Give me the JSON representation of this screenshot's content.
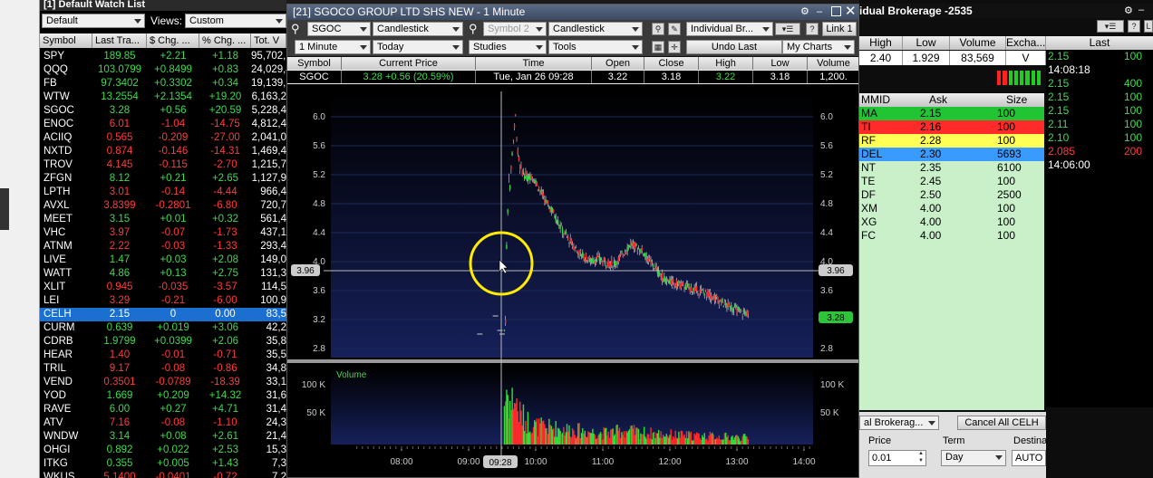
{
  "watchlist": {
    "title": "[1] Default Watch List",
    "list_name": "Default",
    "views_label": "Views:",
    "view_value": "Custom",
    "headers": [
      "Symbol",
      "Last Tra...",
      "$ Chg. ...",
      "% Chg. ...",
      "Tot. V"
    ],
    "rows": [
      {
        "sym": "SPY",
        "last": "189.85",
        "chg": "+2.21",
        "pct": "+1.18",
        "vol": "95,702,7",
        "dir": "up"
      },
      {
        "sym": "QQQ",
        "last": "103.0799",
        "chg": "+0.8499",
        "pct": "+0.83",
        "vol": "24,029,4",
        "dir": "up"
      },
      {
        "sym": "FB",
        "last": "97.3402",
        "chg": "+0.3302",
        "pct": "+0.34",
        "vol": "19,139,6",
        "dir": "up"
      },
      {
        "sym": "WTW",
        "last": "13.2554",
        "chg": "+2.1354",
        "pct": "+19.20",
        "vol": "6,163,2",
        "dir": "up"
      },
      {
        "sym": "SGOC",
        "last": "3.28",
        "chg": "+0.56",
        "pct": "+20.59",
        "vol": "5,228,4",
        "dir": "up"
      },
      {
        "sym": "ENOC",
        "last": "6.01",
        "chg": "-1.04",
        "pct": "-14.75",
        "vol": "4,812,4",
        "dir": "dn"
      },
      {
        "sym": "ACIIQ",
        "last": "0.565",
        "chg": "-0.209",
        "pct": "-27.00",
        "vol": "2,041,0",
        "dir": "dn"
      },
      {
        "sym": "NXTD",
        "last": "0.874",
        "chg": "-0.146",
        "pct": "-14.31",
        "vol": "1,469,4",
        "dir": "dn"
      },
      {
        "sym": "TROV",
        "last": "4.145",
        "chg": "-0.115",
        "pct": "-2.70",
        "vol": "1,215,7",
        "dir": "dn"
      },
      {
        "sym": "ZFGN",
        "last": "8.12",
        "chg": "+0.21",
        "pct": "+2.65",
        "vol": "1,127,9",
        "dir": "up"
      },
      {
        "sym": "LPTH",
        "last": "3.01",
        "chg": "-0.14",
        "pct": "-4.44",
        "vol": "966,4",
        "dir": "dn"
      },
      {
        "sym": "AVXL",
        "last": "3.8399",
        "chg": "-0.2801",
        "pct": "-6.80",
        "vol": "720,7",
        "dir": "dn"
      },
      {
        "sym": "MEET",
        "last": "3.15",
        "chg": "+0.01",
        "pct": "+0.32",
        "vol": "561,4",
        "dir": "up"
      },
      {
        "sym": "VHC",
        "last": "3.97",
        "chg": "-0.07",
        "pct": "-1.73",
        "vol": "437,1",
        "dir": "dn"
      },
      {
        "sym": "ATNM",
        "last": "2.22",
        "chg": "-0.03",
        "pct": "-1.33",
        "vol": "293,4",
        "dir": "dn"
      },
      {
        "sym": "LIVE",
        "last": "1.47",
        "chg": "+0.03",
        "pct": "+2.08",
        "vol": "149,0",
        "dir": "up"
      },
      {
        "sym": "WATT",
        "last": "4.86",
        "chg": "+0.13",
        "pct": "+2.75",
        "vol": "131,3",
        "dir": "up"
      },
      {
        "sym": "XLIT",
        "last": "0.945",
        "chg": "-0.035",
        "pct": "-3.57",
        "vol": "114,5",
        "dir": "dn"
      },
      {
        "sym": "LEI",
        "last": "3.29",
        "chg": "-0.21",
        "pct": "-6.00",
        "vol": "100,9",
        "dir": "dn"
      },
      {
        "sym": "CELH",
        "last": "2.15",
        "chg": "0",
        "pct": "0.00",
        "vol": "83,5",
        "dir": "flat"
      },
      {
        "sym": "CURM",
        "last": "0.639",
        "chg": "+0.019",
        "pct": "+3.06",
        "vol": "42,2",
        "dir": "up"
      },
      {
        "sym": "CDRB",
        "last": "1.9799",
        "chg": "+0.0399",
        "pct": "+2.06",
        "vol": "35,8",
        "dir": "up"
      },
      {
        "sym": "HEAR",
        "last": "1.40",
        "chg": "-0.01",
        "pct": "-0.71",
        "vol": "35,5",
        "dir": "dn"
      },
      {
        "sym": "TRIL",
        "last": "9.17",
        "chg": "-0.08",
        "pct": "-0.86",
        "vol": "34,8",
        "dir": "dn"
      },
      {
        "sym": "VEND",
        "last": "0.3501",
        "chg": "-0.0789",
        "pct": "-18.39",
        "vol": "33,1",
        "dir": "dn"
      },
      {
        "sym": "YOD",
        "last": "1.669",
        "chg": "+0.209",
        "pct": "+14.32",
        "vol": "31,6",
        "dir": "up"
      },
      {
        "sym": "RAVE",
        "last": "6.00",
        "chg": "+0.27",
        "pct": "+4.71",
        "vol": "31,4",
        "dir": "up"
      },
      {
        "sym": "ATV",
        "last": "7.16",
        "chg": "-0.08",
        "pct": "-1.10",
        "vol": "24,3",
        "dir": "dn"
      },
      {
        "sym": "WNDW",
        "last": "3.14",
        "chg": "+0.08",
        "pct": "+2.61",
        "vol": "21,4",
        "dir": "up"
      },
      {
        "sym": "OHGI",
        "last": "0.892",
        "chg": "+0.022",
        "pct": "+2.53",
        "vol": "15,3",
        "dir": "up"
      },
      {
        "sym": "ITKG",
        "last": "0.355",
        "chg": "+0.005",
        "pct": "+1.43",
        "vol": "7,3",
        "dir": "up"
      },
      {
        "sym": "WKUS",
        "last": "5.1400",
        "chg": "-0.0401",
        "pct": "-0.72",
        "vol": "7,2",
        "dir": "dn"
      }
    ]
  },
  "chart_window": {
    "title": "[21] SGOCO GROUP LTD SHS NEW - 1 Minute",
    "symbol": "SGOC",
    "type1": "Candlestick",
    "symbol2_placeholder": "Symbol 2",
    "type2": "Candlestick",
    "broker": "Individual Br...",
    "link": "Link 1",
    "interval": "1 Minute",
    "range": "Today",
    "studies": "Studies",
    "tools": "Tools",
    "undo": "Undo Last",
    "my_charts": "My Charts",
    "quote_headers": [
      "Symbol",
      "Current Price",
      "Time",
      "Open",
      "Close",
      "High",
      "Low",
      "Volume"
    ],
    "quote": {
      "symbol": "SGOC",
      "price": "3.28",
      "change": "+0.56 (20.59%)",
      "time": "Tue, Jan 26  09:28",
      "open": "3.22",
      "close": "3.18",
      "high": "3.22",
      "low": "3.18",
      "volume": "1,200."
    },
    "price_ticks": [
      "6.0",
      "5.6",
      "5.2",
      "4.8",
      "4.4",
      "4.0",
      "3.6",
      "3.2",
      "2.8"
    ],
    "cross_price": "3.96",
    "last_price": "3.28",
    "volume_label": "Volume",
    "vol_ticks": [
      "100 K",
      "50 K"
    ],
    "time_ticks": [
      "08:00",
      "09:00",
      "10:00",
      "11:00",
      "12:00",
      "13:00",
      "14:00"
    ],
    "cursor_time": "09:28"
  },
  "chart_data": {
    "type": "candlestick",
    "x_unit": "minutes since 08:00",
    "ylim": [
      2.7,
      6.35
    ],
    "price_path": [
      [
        92,
        3.05
      ],
      [
        93,
        3.2
      ],
      [
        94,
        4.2
      ],
      [
        95,
        4.7
      ],
      [
        96,
        5.2
      ],
      [
        97,
        5.0
      ],
      [
        98,
        5.3
      ],
      [
        100,
        5.7
      ],
      [
        102,
        6.0
      ],
      [
        104,
        5.5
      ],
      [
        106,
        5.3
      ],
      [
        108,
        5.25
      ],
      [
        110,
        5.2
      ],
      [
        113,
        5.15
      ],
      [
        116,
        5.2
      ],
      [
        120,
        5.1
      ],
      [
        125,
        4.95
      ],
      [
        130,
        4.8
      ],
      [
        135,
        4.7
      ],
      [
        140,
        4.55
      ],
      [
        145,
        4.4
      ],
      [
        150,
        4.3
      ],
      [
        155,
        4.2
      ],
      [
        160,
        4.1
      ],
      [
        165,
        4.05
      ],
      [
        170,
        4.0
      ],
      [
        175,
        4.05
      ],
      [
        180,
        4.0
      ],
      [
        185,
        3.98
      ],
      [
        190,
        3.97
      ],
      [
        195,
        4.05
      ],
      [
        200,
        4.15
      ],
      [
        205,
        4.25
      ],
      [
        210,
        4.2
      ],
      [
        215,
        4.15
      ],
      [
        220,
        4.05
      ],
      [
        225,
        3.95
      ],
      [
        230,
        3.85
      ],
      [
        235,
        3.75
      ],
      [
        240,
        3.72
      ],
      [
        245,
        3.7
      ],
      [
        250,
        3.68
      ],
      [
        255,
        3.65
      ],
      [
        260,
        3.62
      ],
      [
        265,
        3.6
      ],
      [
        270,
        3.58
      ],
      [
        275,
        3.55
      ],
      [
        280,
        3.5
      ],
      [
        285,
        3.45
      ],
      [
        290,
        3.4
      ],
      [
        295,
        3.37
      ],
      [
        300,
        3.33
      ],
      [
        305,
        3.3
      ],
      [
        310,
        3.28
      ]
    ],
    "volume_profile": [
      [
        92,
        90
      ],
      [
        94,
        120
      ],
      [
        96,
        100
      ],
      [
        98,
        80
      ],
      [
        100,
        110
      ],
      [
        102,
        95
      ],
      [
        105,
        70
      ],
      [
        110,
        55
      ],
      [
        120,
        40
      ],
      [
        140,
        35
      ],
      [
        160,
        30
      ],
      [
        180,
        25
      ],
      [
        200,
        30
      ],
      [
        220,
        25
      ],
      [
        250,
        20
      ],
      [
        280,
        18
      ],
      [
        310,
        15
      ]
    ]
  },
  "level2": {
    "title": "idual Brokerage -2535",
    "lii_headers": [
      "High",
      "Low",
      "Volume",
      "Excha..."
    ],
    "lii_values": [
      "2.40",
      "1.929",
      "83,569",
      "V"
    ],
    "headers": [
      "MMID",
      "Ask",
      "Size"
    ],
    "rows": [
      {
        "mmid": "MA",
        "ask": "2.15",
        "size": "100",
        "bg": "#21c433"
      },
      {
        "mmid": "TI",
        "ask": "2.16",
        "size": "100",
        "bg": "#ff2a2a"
      },
      {
        "mmid": "RF",
        "ask": "2.28",
        "size": "100",
        "bg": "#ffff55"
      },
      {
        "mmid": "DEL",
        "ask": "2.30",
        "size": "5693",
        "bg": "#3a9bff"
      },
      {
        "mmid": "NT",
        "ask": "2.35",
        "size": "6100",
        "bg": ""
      },
      {
        "mmid": "TE",
        "ask": "2.45",
        "size": "100",
        "bg": ""
      },
      {
        "mmid": "DF",
        "ask": "2.50",
        "size": "2500",
        "bg": ""
      },
      {
        "mmid": "XM",
        "ask": "4.00",
        "size": "100",
        "bg": ""
      },
      {
        "mmid": "XG",
        "ask": "4.00",
        "size": "100",
        "bg": ""
      },
      {
        "mmid": "FC",
        "ask": "4.00",
        "size": "100",
        "bg": ""
      }
    ]
  },
  "time_sales": {
    "headers": [
      "Last"
    ],
    "rows": [
      {
        "a": "2.15",
        "b": "100",
        "c": "#3fd94f"
      },
      {
        "a": "14:08:18",
        "b": "",
        "c": "#ffffff"
      },
      {
        "a": "2.15",
        "b": "400",
        "c": "#3fd94f"
      },
      {
        "a": "2.15",
        "b": "100",
        "c": "#3fd94f"
      },
      {
        "a": "2.15",
        "b": "100",
        "c": "#3fd94f"
      },
      {
        "a": "2.11",
        "b": "100",
        "c": "#3fd94f"
      },
      {
        "a": "2.10",
        "b": "100",
        "c": "#3fd94f"
      },
      {
        "a": "2.085",
        "b": "200",
        "c": "#ff3b3b"
      },
      {
        "a": "14:06:00",
        "b": "",
        "c": "#ffffff"
      }
    ]
  },
  "order": {
    "account": "al Brokerag...",
    "cancel_all": "Cancel All CELH",
    "price_label": "Price",
    "price_value": "0.01",
    "term_label": "Term",
    "term_value": "Day",
    "dest_label": "Destina",
    "dest_value": "AUTO"
  }
}
